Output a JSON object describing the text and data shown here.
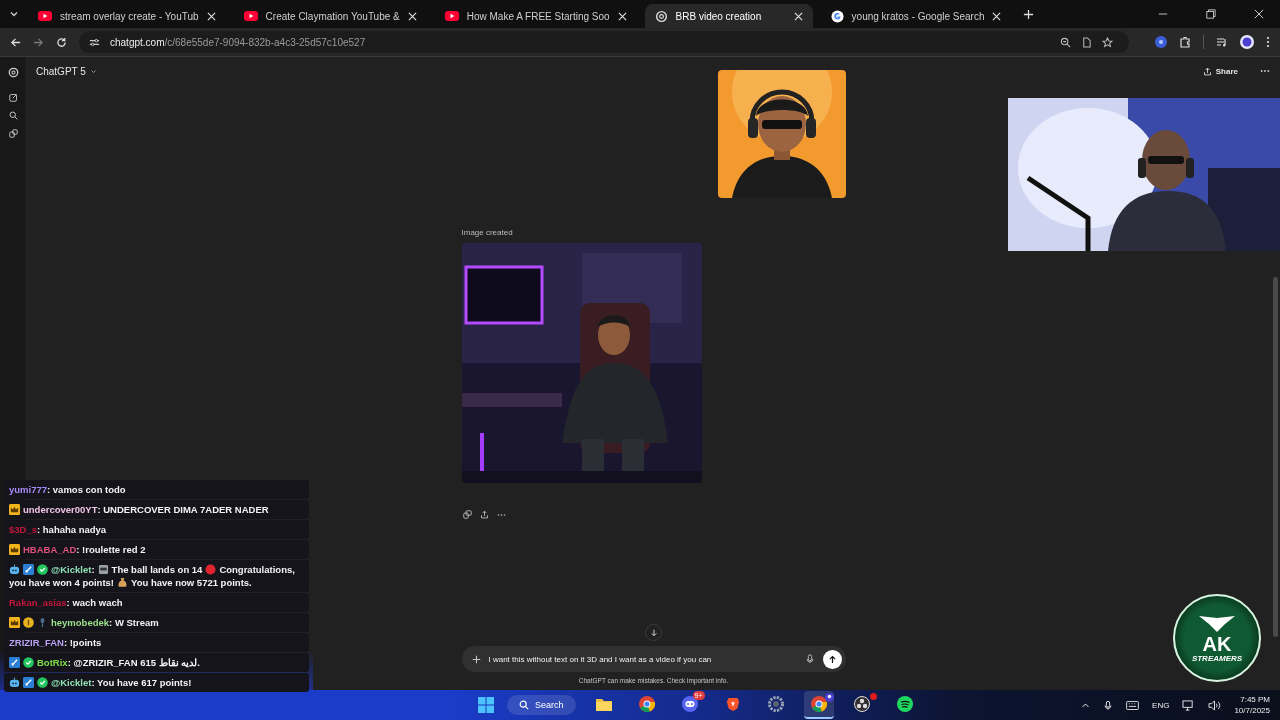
{
  "tabs": [
    {
      "title": "stream overlay create - YouTub",
      "kind": "youtube",
      "selected": false
    },
    {
      "title": "Create Claymation YouTube &",
      "kind": "youtube",
      "selected": false
    },
    {
      "title": "How Make A FREE Starting Soo",
      "kind": "youtube",
      "selected": false
    },
    {
      "title": "BRB video creation",
      "kind": "chatgpt",
      "selected": true
    },
    {
      "title": "young kratos - Google Search",
      "kind": "google",
      "selected": false
    }
  ],
  "address_bar": {
    "host": "chatgpt.com",
    "path": "/c/68e55de7-9094-832b-a4c3-25d57c10e527"
  },
  "chat_header": {
    "model": "ChatGPT 5",
    "share": "Share"
  },
  "conversation": {
    "image_caption": "Image created"
  },
  "composer": {
    "value": "I want this without text on it 3D and I want as a video if you can",
    "disclaimer": "ChatGPT can make mistakes. Check important info."
  },
  "stream_chat": [
    {
      "user": "yumi777",
      "color": "#a78bfa",
      "parts": [
        {
          "kind": "text",
          "text": ": vamos con todo"
        }
      ]
    },
    {
      "user": "undercover00YT",
      "color": "#f3c6e6",
      "badges": [
        {
          "kind": "crown"
        }
      ],
      "parts": [
        {
          "kind": "text",
          "text": ": UNDERCOVER DIMA 7ADER NADER"
        }
      ]
    },
    {
      "user": "$3D_s",
      "color": "#c2183c",
      "parts": [
        {
          "kind": "text",
          "text": ": hahaha nadya"
        }
      ]
    },
    {
      "user": "HBABA_AD",
      "color": "#e0507a",
      "badges": [
        {
          "kind": "crown"
        }
      ],
      "parts": [
        {
          "kind": "text",
          "text": ": !roulette red 2"
        }
      ]
    },
    {
      "user": "@Kicklet",
      "color": "#8fe0b4",
      "badges": [
        {
          "kind": "bot"
        },
        {
          "kind": "sword"
        },
        {
          "kind": "verified"
        }
      ],
      "parts": [
        {
          "kind": "text",
          "text": ":"
        },
        {
          "kind": "slot"
        },
        {
          "kind": "text",
          "text": "The ball lands on 14"
        },
        {
          "kind": "dot"
        },
        {
          "kind": "text",
          "text": "Congratulations,"
        },
        {
          "kind": "text",
          "text": "you have won 4 points!"
        },
        {
          "kind": "money-bag"
        },
        {
          "kind": "text",
          "text": "You have now 5721 points."
        }
      ]
    },
    {
      "user": "Rakan_asias",
      "color": "#c2183c",
      "parts": [
        {
          "kind": "text",
          "text": ": wach wach"
        }
      ]
    },
    {
      "user": "heymobedek",
      "color": "#9be08a",
      "badges": [
        {
          "kind": "crown"
        },
        {
          "kind": "coin"
        },
        {
          "kind": "mic"
        }
      ],
      "parts": [
        {
          "kind": "text",
          "text": ": W Stream"
        }
      ]
    },
    {
      "user": "ZRIZIR_FAN",
      "color": "#b9a0f0",
      "parts": [
        {
          "kind": "text",
          "text": ": !points"
        }
      ]
    },
    {
      "user": "BotRix",
      "color": "#7fe04a",
      "badges": [
        {
          "kind": "sword"
        },
        {
          "kind": "verified"
        }
      ],
      "parts": [
        {
          "kind": "text",
          "text": ": @ZRIZIR_FAN 615 لديه نقاط."
        }
      ]
    },
    {
      "user": "@Kicklet",
      "color": "#8fe0b4",
      "badges": [
        {
          "kind": "bot"
        },
        {
          "kind": "sword"
        },
        {
          "kind": "verified"
        }
      ],
      "parts": [
        {
          "kind": "text",
          "text": ": You have 617 points!"
        }
      ]
    }
  ],
  "stream_logo": {
    "initials": "AK",
    "word": "STREAMERS"
  },
  "taskbar": {
    "search": "Search",
    "apps": [
      {
        "kind": "files",
        "selected": false
      },
      {
        "kind": "chrome",
        "selected": false
      },
      {
        "kind": "discord",
        "selected": false,
        "badge": "9+"
      },
      {
        "kind": "brave",
        "selected": false
      },
      {
        "kind": "settings",
        "selected": false
      },
      {
        "kind": "chrome-profile",
        "selected": true
      },
      {
        "kind": "obs",
        "selected": false,
        "alert": true
      },
      {
        "kind": "spotify",
        "selected": false
      }
    ],
    "language": "ENG",
    "time": "7:45 PM",
    "date": "10/7/2025"
  }
}
